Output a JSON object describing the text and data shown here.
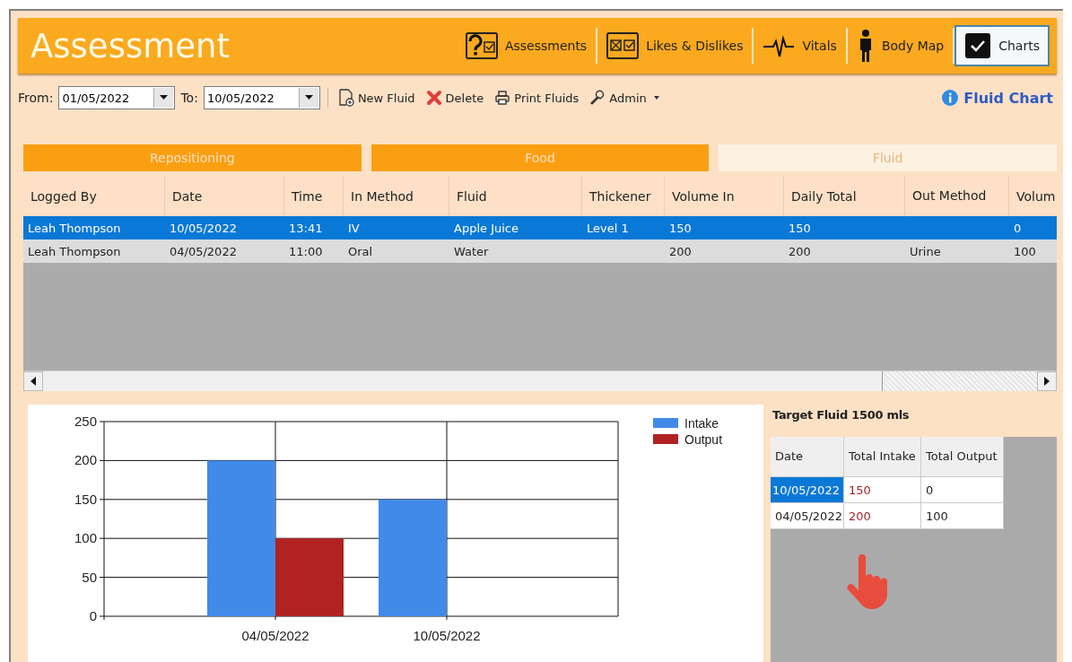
{
  "header": {
    "title": "Assessment",
    "nav": [
      {
        "label": "Assessments",
        "kind": "question",
        "selected": false
      },
      {
        "label": "Likes & Dislikes",
        "kind": "likes",
        "selected": false
      },
      {
        "label": "Vitals",
        "kind": "pulse",
        "selected": false
      },
      {
        "label": "Body Map",
        "kind": "body",
        "selected": false
      },
      {
        "label": "Charts",
        "kind": "check",
        "selected": true
      }
    ]
  },
  "toolbar": {
    "from": {
      "label": "From:",
      "value": "01/05/2022"
    },
    "to": {
      "label": "To:",
      "value": "10/05/2022"
    },
    "actions": [
      {
        "label": "New Fluid",
        "kind": "new"
      },
      {
        "label": "Delete",
        "kind": "delete"
      },
      {
        "label": "Print Fluids",
        "kind": "print"
      },
      {
        "label": "Admin",
        "kind": "admin"
      }
    ],
    "help": "Fluid Chart"
  },
  "category_tabs": [
    {
      "label": "Repositioning",
      "selected": false
    },
    {
      "label": "Food",
      "selected": false
    },
    {
      "label": "Fluid",
      "selected": true
    }
  ],
  "table": {
    "columns": [
      "Logged By",
      "Date",
      "Time",
      "In Method",
      "Fluid",
      "Thickener",
      "Volume In",
      "Daily Total",
      "Out Method",
      "Volum"
    ],
    "rows": [
      {
        "selected": true,
        "cells": [
          "Leah Thompson",
          "10/05/2022",
          "13:41",
          "IV",
          "Apple Juice",
          "Level 1",
          "150",
          "150",
          "",
          "0"
        ]
      },
      {
        "selected": false,
        "cells": [
          "Leah Thompson",
          "04/05/2022",
          "11:00",
          "Oral",
          "Water",
          "",
          "200",
          "200",
          "Urine",
          "100"
        ]
      }
    ]
  },
  "chart_data": {
    "type": "bar",
    "categories": [
      "04/05/2022",
      "10/05/2022"
    ],
    "series": [
      {
        "name": "Intake",
        "color": "#428ae8",
        "values": [
          200,
          150
        ]
      },
      {
        "name": "Output",
        "color": "#b22222",
        "values": [
          100,
          0
        ]
      }
    ],
    "ylim": [
      0,
      250
    ],
    "yticks": [
      0,
      50,
      100,
      150,
      200,
      250
    ],
    "grid": true,
    "legend": "upper right"
  },
  "summary": {
    "title": "Target Fluid 1500 mls",
    "columns": [
      "Date",
      "Total Intake",
      "Total Output"
    ],
    "rows": [
      {
        "selected": true,
        "cells": [
          "10/05/2022",
          "150",
          "0"
        ]
      },
      {
        "selected": false,
        "cells": [
          "04/05/2022",
          "200",
          "100"
        ]
      }
    ]
  }
}
